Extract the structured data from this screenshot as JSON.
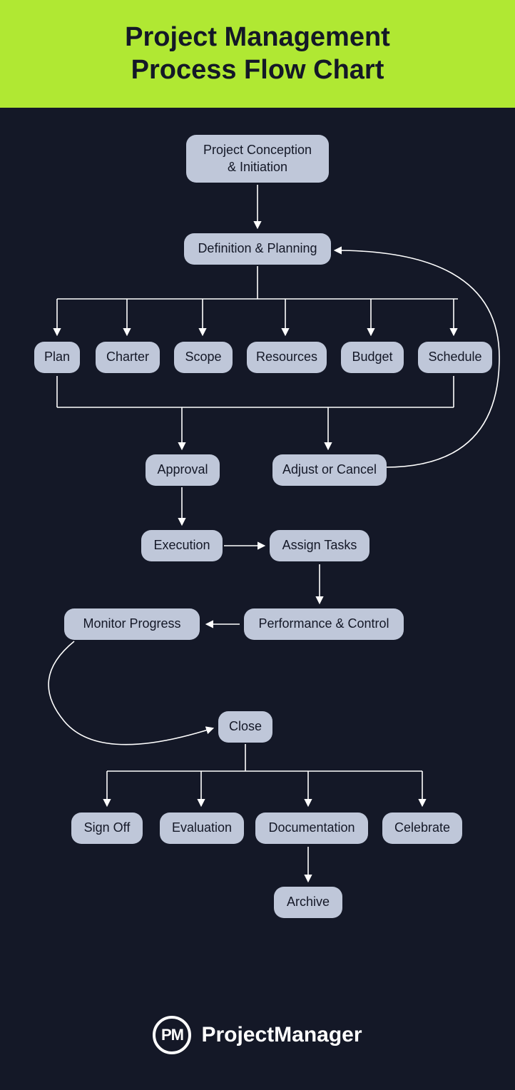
{
  "header": {
    "title_line1": "Project Management",
    "title_line2": "Process Flow Chart"
  },
  "nodes": {
    "conception": "Project Conception & Initiation",
    "definition": "Definition & Planning",
    "plan": "Plan",
    "charter": "Charter",
    "scope": "Scope",
    "resources": "Resources",
    "budget": "Budget",
    "schedule": "Schedule",
    "approval": "Approval",
    "adjust": "Adjust or Cancel",
    "execution": "Execution",
    "assign": "Assign Tasks",
    "monitor": "Monitor Progress",
    "performance": "Performance & Control",
    "close": "Close",
    "signoff": "Sign Off",
    "evaluation": "Evaluation",
    "documentation": "Documentation",
    "celebrate": "Celebrate",
    "archive": "Archive"
  },
  "footer": {
    "badge": "PM",
    "brand": "ProjectManager"
  },
  "colors": {
    "accent": "#b0e833",
    "background": "#141827",
    "node_bg": "#bfc7d9"
  }
}
